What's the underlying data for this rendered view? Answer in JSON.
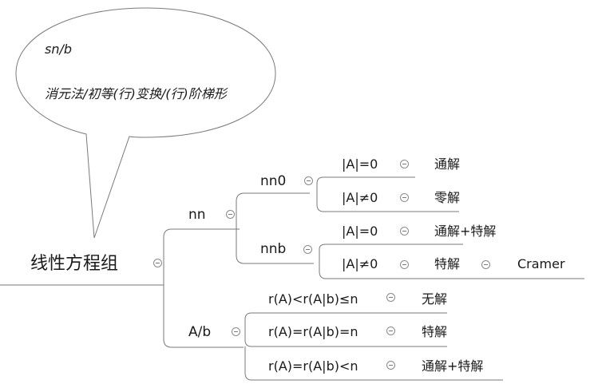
{
  "root": {
    "label": "线性方程组"
  },
  "note": {
    "line1": "sn/b",
    "line2": "消元法/初等(行)变换/(行)阶梯形"
  },
  "branch_nn": {
    "label": "nn",
    "nn0": {
      "label": "nn0",
      "leaves": [
        {
          "cond": "|A|=0",
          "result": "通解"
        },
        {
          "cond": "|A|≠0",
          "result": "零解"
        }
      ]
    },
    "nnb": {
      "label": "nnb",
      "leaves": [
        {
          "cond": "|A|=0",
          "result": "通解+特解"
        },
        {
          "cond": "|A|≠0",
          "result": "特解",
          "extra": "Cramer"
        }
      ]
    }
  },
  "branch_ab": {
    "label": "A/b",
    "leaves": [
      {
        "cond": "r(A)<r(A|b)≤n",
        "result": "无解"
      },
      {
        "cond": "r(A)=r(A|b)=n",
        "result": "特解"
      },
      {
        "cond": "r(A)=r(A|b)<n",
        "result": "通解+特解"
      }
    ]
  }
}
